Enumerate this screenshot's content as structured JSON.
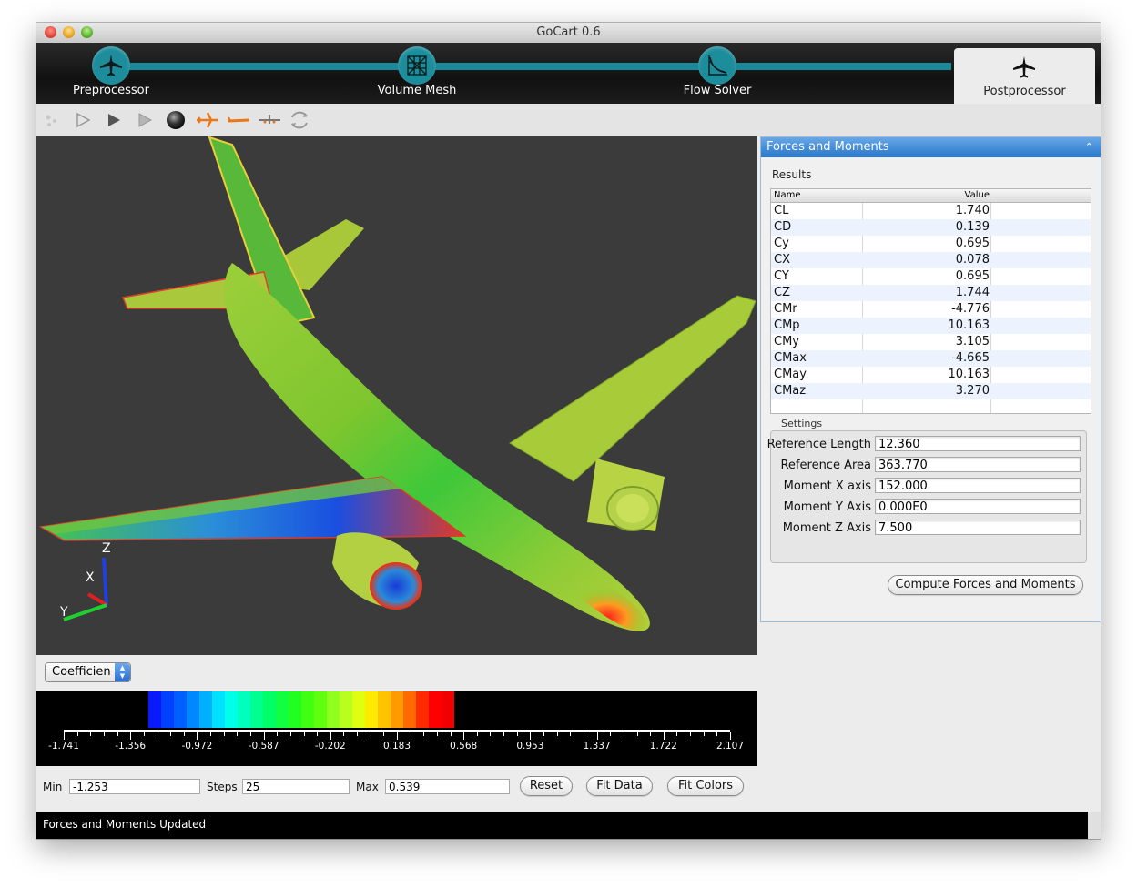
{
  "window": {
    "title": "GoCart 0.6"
  },
  "steps": [
    {
      "label": "Preprocessor",
      "icon": "airplane-icon"
    },
    {
      "label": "Volume Mesh",
      "icon": "mesh-icon"
    },
    {
      "label": "Flow Solver",
      "icon": "solver-plot-icon"
    },
    {
      "label": "Postprocessor",
      "icon": "airplane-icon",
      "active": true
    }
  ],
  "toolbar": [
    "dots-icon",
    "play-outline-icon",
    "play-icon",
    "play-light-icon",
    "sphere-icon",
    "plane-orange-icon",
    "plane-side-icon",
    "plane-front-icon",
    "rotate-icon"
  ],
  "viewport": {
    "axes": {
      "z": "Z",
      "x": "X",
      "y": "Y"
    },
    "background": "#3b3b3b"
  },
  "panel": {
    "title": "Forces and Moments",
    "collapse_icon": "chevron-up-icon",
    "results_label": "Results",
    "table": {
      "headers": [
        "Name",
        "Value"
      ],
      "rows": [
        [
          "CL",
          "1.740"
        ],
        [
          "CD",
          "0.139"
        ],
        [
          "Cy",
          "0.695"
        ],
        [
          "CX",
          "0.078"
        ],
        [
          "CY",
          "0.695"
        ],
        [
          "CZ",
          "1.744"
        ],
        [
          "CMr",
          "-4.776"
        ],
        [
          "CMp",
          "10.163"
        ],
        [
          "CMy",
          "3.105"
        ],
        [
          "CMax",
          "-4.665"
        ],
        [
          "CMay",
          "10.163"
        ],
        [
          "CMaz",
          "3.270"
        ]
      ]
    },
    "settings": {
      "label": "Settings",
      "fields": [
        {
          "label": "Reference Length",
          "value": "12.360"
        },
        {
          "label": "Reference Area",
          "value": "363.770"
        },
        {
          "label": "Moment X axis",
          "value": "152.000"
        },
        {
          "label": "Moment Y Axis",
          "value": "0.000E0"
        },
        {
          "label": "Moment Z Axis",
          "value": "7.500"
        }
      ]
    },
    "compute_button": "Compute Forces and Moments"
  },
  "legend": {
    "selector": "Coefficien",
    "ticks": [
      "-1.741",
      "-1.356",
      "-0.972",
      "-0.587",
      "-0.202",
      "0.183",
      "0.568",
      "0.953",
      "1.337",
      "1.722",
      "2.107"
    ],
    "colors": [
      "#0a1aff",
      "#0040ff",
      "#0060ff",
      "#0088ff",
      "#00b0ff",
      "#00e0ff",
      "#00ffe8",
      "#00ffbf",
      "#00ff90",
      "#00ff66",
      "#10ff40",
      "#20ff20",
      "#40ff10",
      "#60ff10",
      "#90ff20",
      "#b8ff20",
      "#e0ff10",
      "#ffea00",
      "#ffc400",
      "#ff9a00",
      "#ff6a00",
      "#ff2a00",
      "#ff0000",
      "#f00000"
    ]
  },
  "range": {
    "min_label": "Min",
    "min_value": "-1.253",
    "steps_label": "Steps",
    "steps_value": "25",
    "max_label": "Max",
    "max_value": "0.539",
    "reset": "Reset",
    "fit_data": "Fit Data",
    "fit_colors": "Fit Colors"
  },
  "status": "Forces and Moments Updated"
}
